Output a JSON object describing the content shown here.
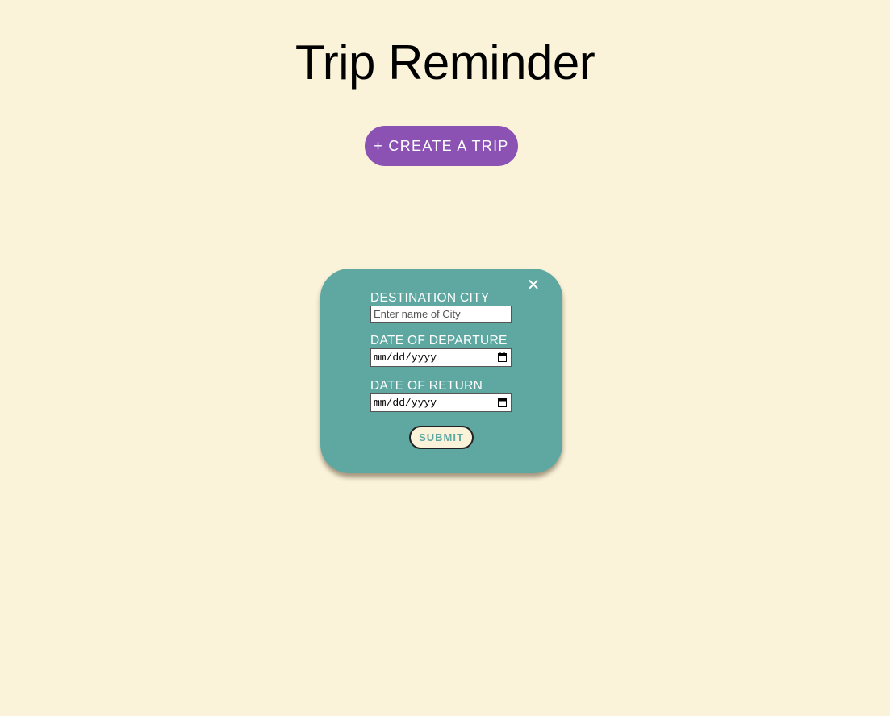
{
  "page": {
    "title": "Trip Reminder"
  },
  "actions": {
    "create_trip_label": "+ CREATE A TRIP"
  },
  "modal": {
    "close_glyph": "✕",
    "close_icon": "close-icon",
    "fields": {
      "destination": {
        "label": "DESTINATION CITY",
        "placeholder": "Enter name of City",
        "value": ""
      },
      "departure": {
        "label": "DATE OF DEPARTURE",
        "value": "mm/dd/yyyy",
        "icon": "calendar-icon"
      },
      "return": {
        "label": "DATE OF RETURN",
        "value": "mm/dd/yyyy",
        "icon": "calendar-icon"
      }
    },
    "submit_label": "SUBMIT"
  },
  "colors": {
    "background": "#faf2d9",
    "accent_purple": "#8b52b4",
    "modal_teal": "#5fa8a2"
  }
}
